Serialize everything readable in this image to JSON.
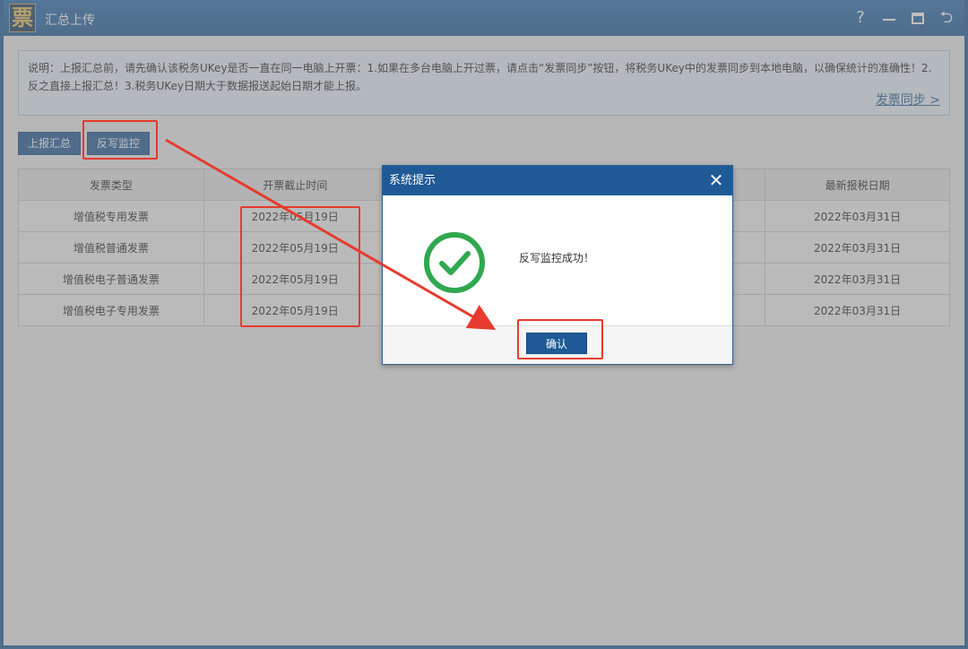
{
  "window": {
    "title": "汇总上传",
    "logo_char": "票",
    "controls": {
      "help": "?",
      "restore": "⮌"
    }
  },
  "notice": {
    "text": "说明：上报汇总前，请先确认该税务UKey是否一直在同一电脑上开票：1.如果在多台电脑上开过票，请点击“发票同步”按钮，将税务UKey中的发票同步到本地电脑，以确保统计的准确性！2.反之直接上报汇总！3.税务UKey日期大于数据报送起始日期才能上报。",
    "sync_link": "发票同步 >"
  },
  "toolbar": {
    "report_summary": "上报汇总",
    "write_back_monitor": "反写监控"
  },
  "table": {
    "headers": [
      "发票类型",
      "开票截止时间",
      "",
      "",
      "最新报税日期"
    ],
    "rows": [
      [
        "增值税专用发票",
        "2022年05月19日",
        "",
        "",
        "2022年03月31日"
      ],
      [
        "增值税普通发票",
        "2022年05月19日",
        "",
        "",
        "2022年03月31日"
      ],
      [
        "增值税电子普通发票",
        "2022年05月19日",
        "",
        "",
        "2022年03月31日"
      ],
      [
        "增值税电子专用发票",
        "2022年05月19日",
        "",
        "",
        "2022年03月31日"
      ]
    ]
  },
  "dialog": {
    "title": "系统提示",
    "close": "✕",
    "message": "反写监控成功！",
    "ok": "确认"
  },
  "colors": {
    "accent": "#1f5a96",
    "highlight": "#e63b2e",
    "success": "#2fa84f"
  }
}
